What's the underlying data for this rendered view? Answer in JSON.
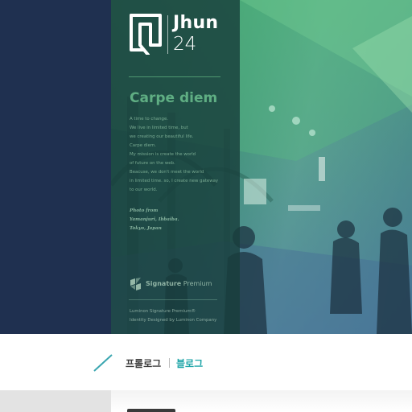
{
  "brand": {
    "name": "Jhun",
    "number": "24"
  },
  "hero": {
    "tagline": "Carpe diem",
    "body_lines": [
      "A time to change.",
      "We live in limited time, but",
      "we creating our beautiful life.",
      "Carpe diem.",
      "My mission is create the world",
      "of future on the web.",
      "Beacuse, we don't meet the world",
      "in limited time. so, I create new gateway",
      "to our world."
    ],
    "credit_lines": [
      "Photo from",
      "Yamanjuri, Ibbaiba.",
      "Tokyo, Japan"
    ],
    "signature": {
      "bold": "Signature",
      "rest": "Premium"
    },
    "footnote_lines": [
      "Luminon Signature Premium®",
      "Identity Designed by Luminon Company"
    ]
  },
  "nav": {
    "items": [
      {
        "label": "프롤로그"
      },
      {
        "label": "블로그"
      }
    ]
  },
  "colors": {
    "dark_navy": "#1f3050",
    "panel_green": "#193e3c",
    "accent_green": "#5fae83",
    "accent_teal": "#1fa5a8"
  }
}
